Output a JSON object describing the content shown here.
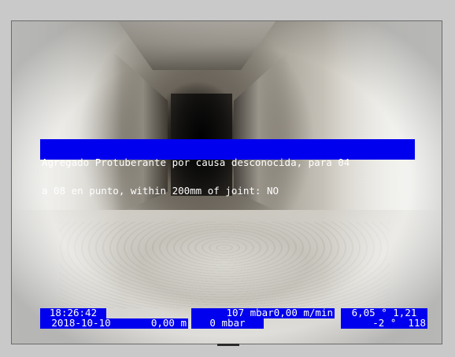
{
  "observation": {
    "line1": "Agregado Protuberante por causa desconocida, para 04",
    "line2": "a 08 en punto, within 200mm of joint: NO"
  },
  "readout": {
    "time": "18:26:42",
    "date": "2018-10-10",
    "distance": "0,00 m",
    "pressure_rate": "107 mbar0,00 m/min",
    "pressure": "0 mbar",
    "angle_incl": "6,05 ° 1,21",
    "angle_rot": "-2 °  118"
  },
  "colors": {
    "overlay_bg": "#0000ee",
    "overlay_text": "#ffffff",
    "frame_bg": "#c9c9c9"
  }
}
